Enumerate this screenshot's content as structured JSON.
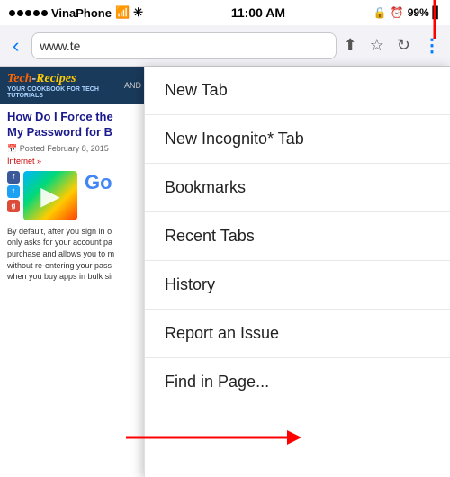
{
  "statusBar": {
    "carrier": "VinaPhone",
    "wifi": "WiFi",
    "time": "11:00 AM",
    "battery": "99%",
    "batteryIcon": "🔋"
  },
  "toolbar": {
    "backLabel": "‹",
    "addressText": "www.te",
    "shareIcon": "⬆",
    "bookmarkIcon": "☆",
    "reloadIcon": "↻",
    "moreIcon": "⋮"
  },
  "pageContent": {
    "siteName": "Tech-Recipes",
    "siteTagline": "YOUR COOKBOOK FOR TECH TUTORIALS",
    "headerRight": "AND",
    "articleTitle": "How Do I Force the\nMy Password for B",
    "articleMeta": "📅 Posted February 8, 2015",
    "articleCategory": "Internet »",
    "articleBodyText": "By default, after you sign in o\nonly asks for your account pa\npurchase and allows you to m\nwithout re-entering your pass\nwhen you buy apps in bulk sir"
  },
  "menu": {
    "items": [
      {
        "label": "New Tab"
      },
      {
        "label": "New Incognito* Tab"
      },
      {
        "label": "Bookmarks"
      },
      {
        "label": "Recent Tabs"
      },
      {
        "label": "History"
      },
      {
        "label": "Report an Issue"
      },
      {
        "label": "Find in Page..."
      }
    ]
  }
}
